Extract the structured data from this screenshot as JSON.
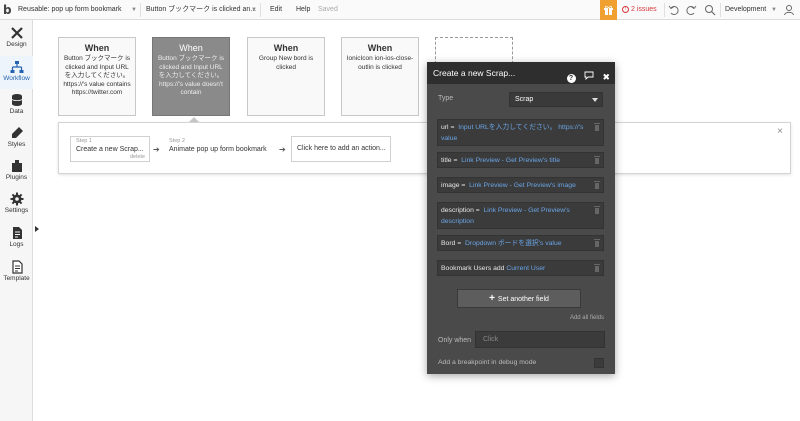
{
  "topbar": {
    "page_name": "Reusable: pop up form bookmark",
    "event_selector": "Button ブックマーク is clicked an...",
    "edit_label": "Edit",
    "help_label": "Help",
    "saved_label": "Saved",
    "issues_label": "2 issues",
    "env_label": "Development",
    "accent_color": "#f0a030",
    "issues_color": "#d9353b"
  },
  "sidebar": {
    "items": [
      {
        "label": "Design",
        "icon": "design-icon"
      },
      {
        "label": "Workflow",
        "icon": "workflow-icon"
      },
      {
        "label": "Data",
        "icon": "data-icon"
      },
      {
        "label": "Styles",
        "icon": "styles-icon"
      },
      {
        "label": "Plugins",
        "icon": "plugins-icon"
      },
      {
        "label": "Settings",
        "icon": "settings-icon"
      },
      {
        "label": "Logs",
        "icon": "logs-icon"
      },
      {
        "label": "Template",
        "icon": "template-icon"
      }
    ]
  },
  "events": [
    {
      "when": "When",
      "desc": "Button ブックマーク is clicked and Input URL を入力してください。 https://'s value contains https://twitter.com"
    },
    {
      "when": "When",
      "desc": "Button ブックマーク is clicked and Input URL を入力してください。 https://'s value doesn't contain"
    },
    {
      "when": "When",
      "desc": "Group New bord is clicked"
    },
    {
      "when": "When",
      "desc": "IonicIcon ion-ios-close-outlin is clicked"
    }
  ],
  "steps": {
    "close": "×",
    "step1": {
      "small": "Step 1",
      "main": "Create a new Scrap...",
      "delete": "delete"
    },
    "step2": {
      "small": "Step 2",
      "main": "Animate pop up form bookmark"
    },
    "add_action": "Click here to add an action..."
  },
  "editor": {
    "title": "Create a new Scrap...",
    "help_icon": "?",
    "comment_icon": "💬",
    "close_icon": "✖",
    "type_label": "Type",
    "type_value": "Scrap",
    "fields": [
      {
        "key": "url",
        "eq": "=",
        "value": "Input URLを入力してください。 https://'s value"
      },
      {
        "key": "title",
        "eq": "=",
        "value": "Link Preview - Get Preview's title"
      },
      {
        "key": "image",
        "eq": "=",
        "value": "Link Preview - Get Preview's image"
      },
      {
        "key": "description",
        "eq": "=",
        "value": "Link Preview - Get Preview's description"
      },
      {
        "key": "Bord",
        "eq": "=",
        "value": "Dropdown ボードを選択's value"
      },
      {
        "key": "Bookmark Users add",
        "eq": "",
        "value": "Current User"
      }
    ],
    "set_another": "Set another field",
    "set_plus": "+",
    "add_all": "Add all fields",
    "only_when_label": "Only when",
    "only_when_placeholder": "Click",
    "breakpoint_label": "Add a breakpoint in debug mode",
    "link_color": "#6aa5e6"
  }
}
